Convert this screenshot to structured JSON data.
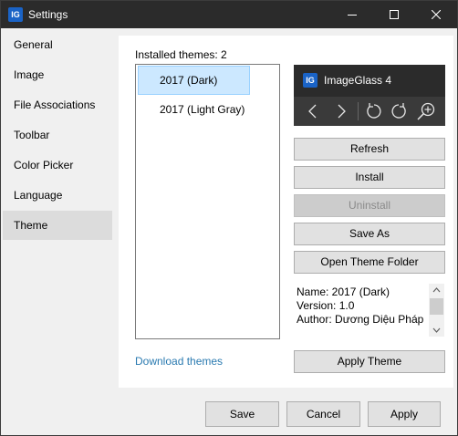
{
  "window": {
    "title": "Settings",
    "app_icon_text": "IG"
  },
  "sidebar": {
    "items": [
      {
        "label": "General"
      },
      {
        "label": "Image"
      },
      {
        "label": "File Associations"
      },
      {
        "label": "Toolbar"
      },
      {
        "label": "Color Picker"
      },
      {
        "label": "Language"
      },
      {
        "label": "Theme",
        "active": true
      }
    ]
  },
  "theme_panel": {
    "installed_label": "Installed themes: 2",
    "themes": [
      {
        "label": "2017 (Dark)",
        "selected": true
      },
      {
        "label": "2017 (Light Gray)",
        "selected": false
      }
    ],
    "preview": {
      "app_name": "ImageGlass 4",
      "icons": [
        "chevron-left-icon",
        "chevron-right-icon",
        "rotate-left-icon",
        "rotate-right-icon",
        "zoom-in-icon"
      ]
    },
    "buttons": {
      "refresh": "Refresh",
      "install": "Install",
      "uninstall": "Uninstall",
      "save_as": "Save As",
      "open_folder": "Open Theme Folder",
      "apply_theme": "Apply Theme"
    },
    "info": {
      "name": "Name: 2017 (Dark)",
      "version": "Version: 1.0",
      "author": "Author: Dương Diệu Pháp"
    },
    "download_link": "Download themes"
  },
  "footer": {
    "save": "Save",
    "cancel": "Cancel",
    "apply": "Apply"
  },
  "colors": {
    "titlebar": "#2b2b2b",
    "selection": "#cce8ff",
    "link": "#2a7ab0",
    "accent": "#1a63c6"
  }
}
